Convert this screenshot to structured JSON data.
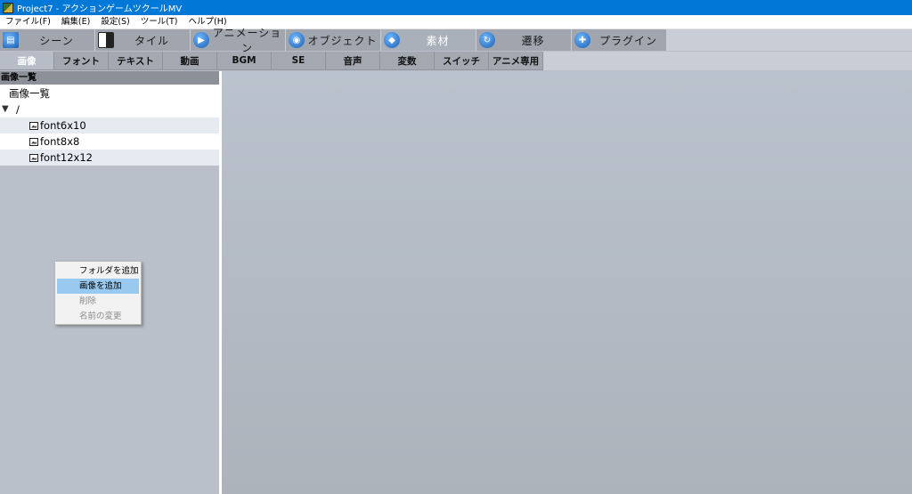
{
  "window": {
    "title": "Project7 - アクションゲームツクールMV"
  },
  "menubar": [
    "ファイル(F)",
    "編集(E)",
    "設定(S)",
    "ツール(T)",
    "ヘルプ(H)"
  ],
  "main_tabs": [
    {
      "label": "シーン",
      "icon": "scene-icon",
      "active": false
    },
    {
      "label": "タイル",
      "icon": "tile-icon",
      "active": false
    },
    {
      "label": "アニメーション",
      "icon": "animation-icon",
      "active": false
    },
    {
      "label": "オブジェクト",
      "icon": "object-icon",
      "active": false
    },
    {
      "label": "素材",
      "icon": "resource-icon",
      "active": true
    },
    {
      "label": "遷移",
      "icon": "transition-icon",
      "active": false
    },
    {
      "label": "プラグイン",
      "icon": "plugin-icon",
      "active": false
    }
  ],
  "sub_tabs": [
    {
      "label": "画像",
      "active": true
    },
    {
      "label": "フォント",
      "active": false
    },
    {
      "label": "テキスト",
      "active": false
    },
    {
      "label": "動画",
      "active": false
    },
    {
      "label": "BGM",
      "active": false
    },
    {
      "label": "SE",
      "active": false
    },
    {
      "label": "音声",
      "active": false
    },
    {
      "label": "変数",
      "active": false
    },
    {
      "label": "スイッチ",
      "active": false
    },
    {
      "label": "アニメ専用",
      "active": false
    }
  ],
  "left_panel": {
    "header": "画像一覧",
    "root_label": "画像一覧",
    "folder_label": "/",
    "items": [
      "font6x10",
      "font8x8",
      "font12x12"
    ]
  },
  "context_menu": {
    "items": [
      {
        "label": "フォルダを追加",
        "state": "normal"
      },
      {
        "label": "画像を追加",
        "state": "hover"
      },
      {
        "label": "削除",
        "state": "disabled"
      },
      {
        "label": "名前の変更",
        "state": "disabled"
      }
    ]
  },
  "colors": {
    "titlebar": "#0078d7",
    "hover": "#99c9ef",
    "workspace": "#b8bfca"
  }
}
